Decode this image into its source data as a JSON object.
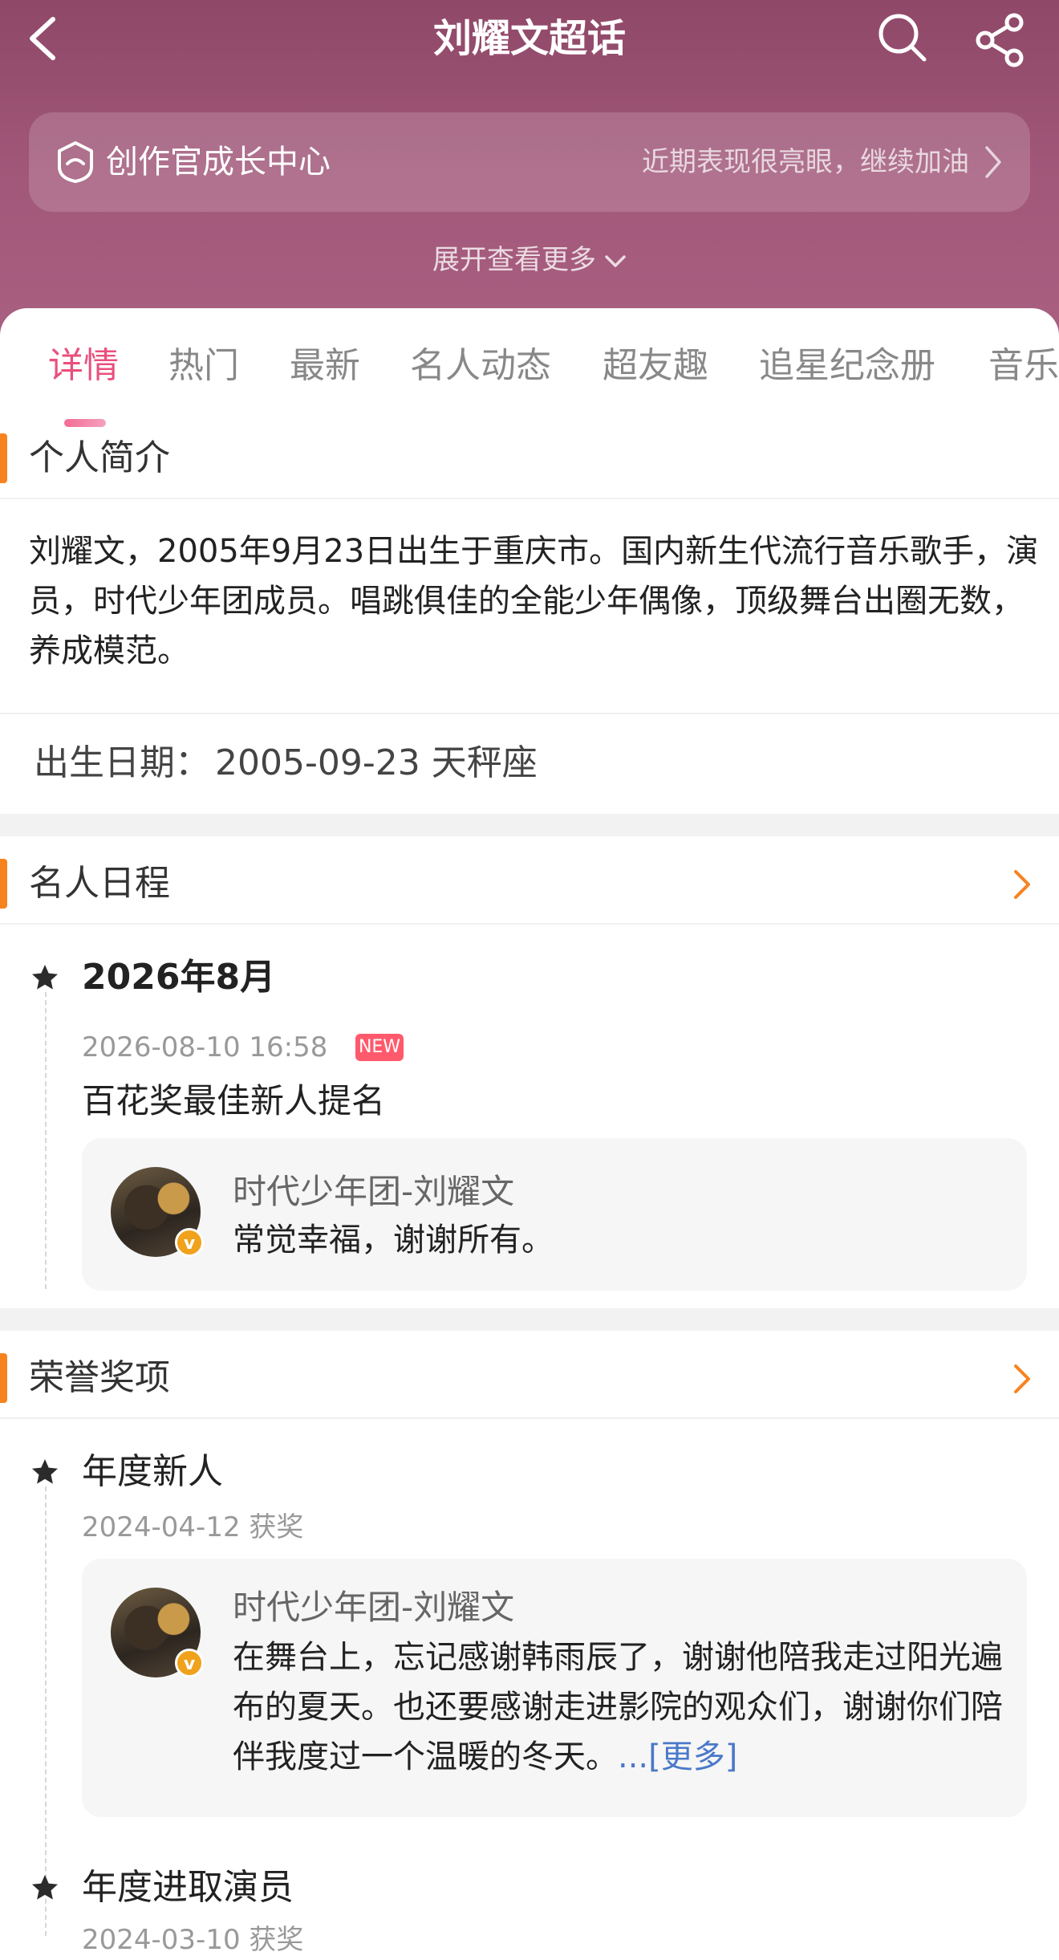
{
  "header": {
    "title": "刘耀文超话",
    "growth": {
      "label": "创作官成长中心",
      "hint": "近期表现很亮眼，继续加油"
    },
    "expand_label": "展开查看更多"
  },
  "tabs": [
    "详情",
    "热门",
    "最新",
    "名人动态",
    "超友趣",
    "追星纪念册",
    "音乐"
  ],
  "profile": {
    "section_title": "个人简介",
    "bio": "刘耀文，2005年9月23日出生于重庆市。国内新生代流行音乐歌手，演员，时代少年团成员。唱跳俱佳的全能少年偶像，顶级舞台出圈无数，养成模范。",
    "birth_label": "出生日期：",
    "birth_value": "2005-09-23  天秤座"
  },
  "schedule": {
    "section_title": "名人日程",
    "month": "2026年8月",
    "time": "2026-08-10 16:58",
    "badge": "NEW",
    "event": "百花奖最佳新人提名",
    "post": {
      "author": "时代少年团-刘耀文",
      "text": "常觉幸福，谢谢所有。"
    }
  },
  "honors": {
    "section_title": "荣誉奖项",
    "items": [
      {
        "title": "年度新人",
        "date": "2024-04-12 获奖",
        "post": {
          "author": "时代少年团-刘耀文",
          "text": "在舞台上，忘记感谢韩雨辰了，谢谢他陪我走过阳光遍布的夏天。也还要感谢走进影院的观众们，谢谢你们陪伴我度过一个温暖的冬天。",
          "more": "...[更多]"
        }
      },
      {
        "title": "年度进取演员",
        "date": "2024-03-10 获奖"
      }
    ]
  },
  "colors": {
    "header_bg": "#9a5274",
    "active_tab": "#ea4f7d",
    "section_accent": "#f7831f",
    "new_badge": "#ff5a6c",
    "link": "#4a79c9"
  }
}
